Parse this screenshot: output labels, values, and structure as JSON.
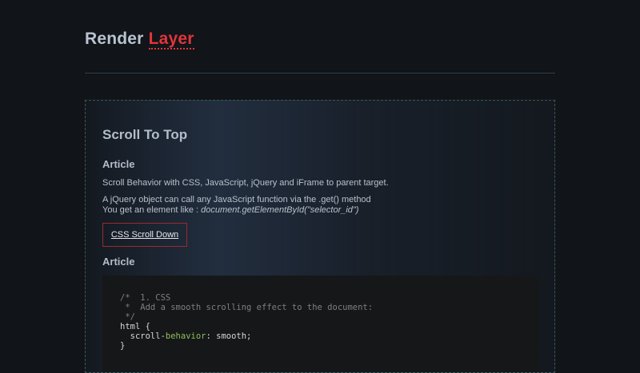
{
  "site": {
    "title_main": "Render",
    "title_accent": "Layer"
  },
  "panel": {
    "title": "Scroll To Top",
    "article_heading_1": "Article",
    "paragraph_1": "Scroll Behavior with CSS, JavaScript, jQuery and iFrame to parent target.",
    "paragraph_2_line_1": "A jQuery object can call any JavaScript function via the .get() method",
    "paragraph_2_line_2_prefix": "You get an element like : ",
    "paragraph_2_line_2_code": "document.getElementById(\"selector_id\")",
    "link_label": "CSS Scroll Down",
    "article_heading_2": "Article"
  },
  "code": {
    "line1": "/*  1. CSS",
    "line2": " *  Add a smooth scrolling effect to the document:",
    "line3": " */",
    "line4": "html {",
    "line5_pre": "  scroll-",
    "line5_kw": "behavior",
    "line5_post": ": smooth;",
    "line6": "}"
  },
  "colors": {
    "accent": "#e0353b",
    "background": "#111418",
    "link_border": "#9a2a30"
  }
}
